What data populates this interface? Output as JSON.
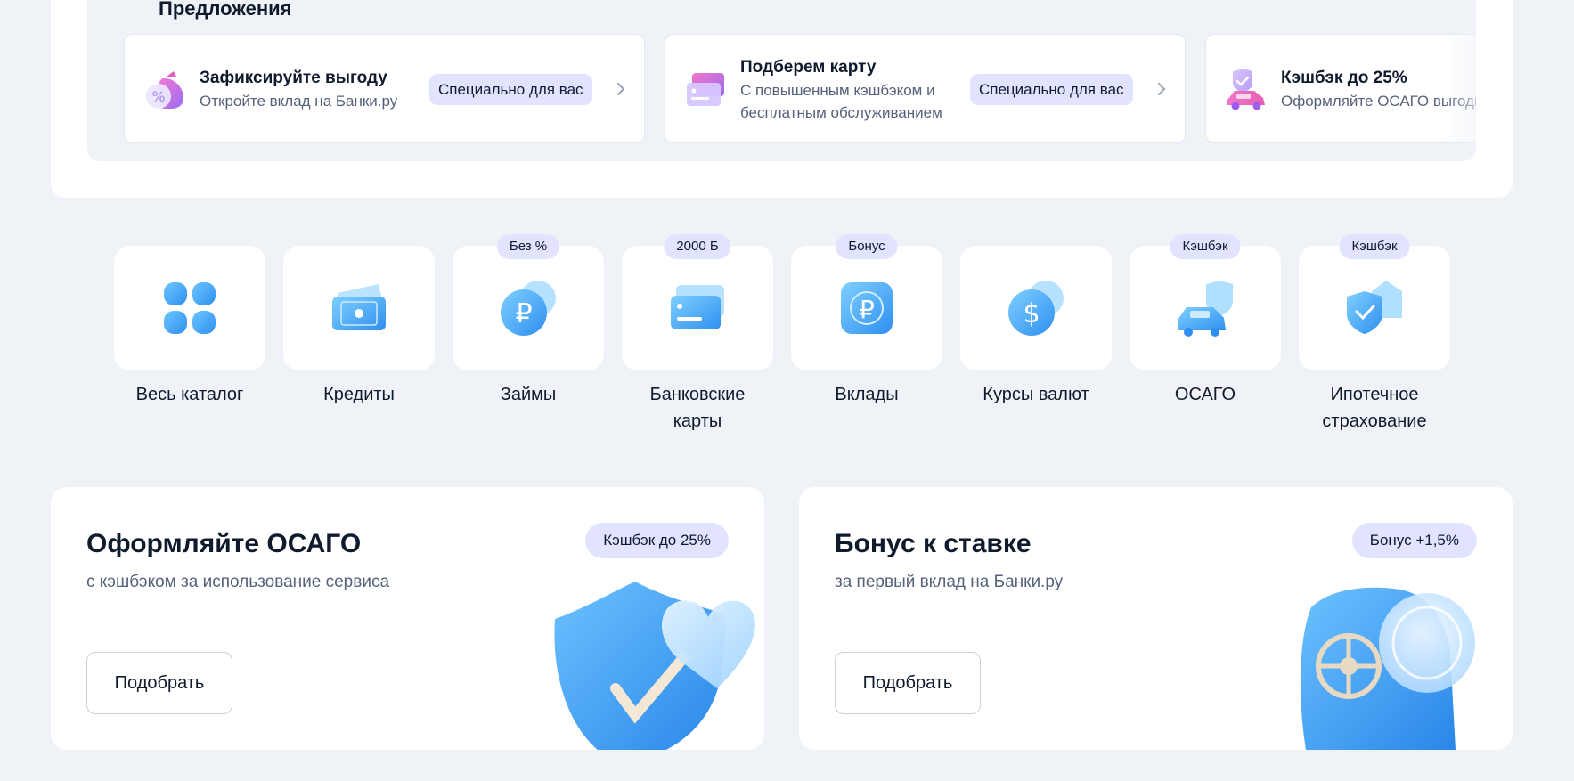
{
  "offers": {
    "title": "Предложения",
    "cards": [
      {
        "title": "Зафиксируйте выгоду",
        "subtitle": "Откройте вклад на Банки.ру",
        "badge": "Специально для вас"
      },
      {
        "title": "Подберем карту",
        "subtitle_line1": "С повышенным кэшбэком и",
        "subtitle_line2": "бесплатным обслуживанием",
        "badge": "Специально для вас"
      },
      {
        "title": "Кэшбэк до 25%",
        "subtitle": "Оформляйте ОСАГО выгодно"
      }
    ]
  },
  "categories": [
    {
      "label": "Весь каталог",
      "badge": "",
      "icon": "grid-icon"
    },
    {
      "label": "Кредиты",
      "badge": "",
      "icon": "cash-icon"
    },
    {
      "label": "Займы",
      "badge": "Без %",
      "icon": "ruble-coins-icon"
    },
    {
      "label_line1": "Банковские",
      "label_line2": "карты",
      "badge": "2000 Б",
      "icon": "bank-card-icon"
    },
    {
      "label": "Вклады",
      "badge": "Бонус",
      "icon": "ruble-deposit-icon"
    },
    {
      "label": "Курсы валют",
      "badge": "",
      "icon": "dollar-coins-icon"
    },
    {
      "label": "ОСАГО",
      "badge": "Кэшбэк",
      "icon": "car-shield-icon"
    },
    {
      "label_line1": "Ипотечное",
      "label_line2": "страхование",
      "badge": "Кэшбэк",
      "icon": "house-shield-icon"
    }
  ],
  "promos": [
    {
      "title": "Оформляйте ОСАГО",
      "subtitle": "с кэшбэком за использование сервиса",
      "badge": "Кэшбэк до 25%",
      "button": "Подобрать",
      "icon": "shield-heart-icon"
    },
    {
      "title": "Бонус к ставке",
      "subtitle": "за первый вклад на Банки.ру",
      "badge": "Бонус +1,5%",
      "button": "Подобрать",
      "icon": "safe-icon"
    }
  ],
  "colors": {
    "accent": "#0c7dff",
    "badge_bg": "#e1e3ff",
    "page_bg": "#eff3f8",
    "icon_blue": "#37a5f5"
  }
}
